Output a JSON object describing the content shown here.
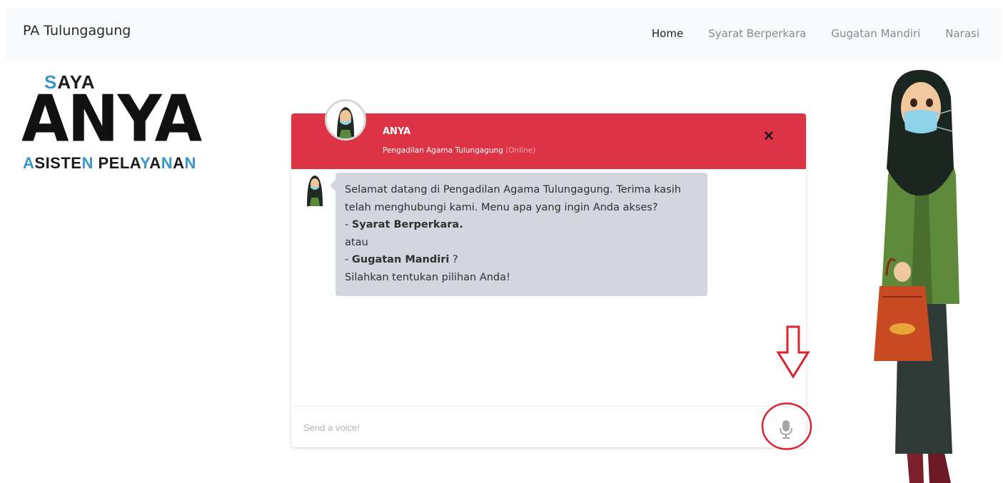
{
  "navbar": {
    "brand": "PA Tulungagung",
    "links": [
      {
        "label": "Home",
        "active": true
      },
      {
        "label": "Syarat Berperkara",
        "active": false
      },
      {
        "label": "Gugatan Mandiri",
        "active": false
      },
      {
        "label": "Narasi",
        "active": false
      }
    ]
  },
  "logo": {
    "saya_accent": "S",
    "saya_rest": "AYA",
    "anya": "ANYA",
    "asisten_parts": [
      "A",
      "SISTE",
      "N",
      " PELA",
      "Y",
      "A",
      "N",
      "A",
      "N"
    ],
    "accent_color": "#3b95c6"
  },
  "chat": {
    "name": "ANYA",
    "subtitle": "Pengadilan Agama Tulungagung",
    "status": "(Online)",
    "close_icon": "close-icon",
    "header_color": "#dc3444",
    "message": {
      "line1": "Selamat datang di Pengadilan Agama Tulungagung. Terima kasih telah menghubungi kami. Menu apa yang ingin Anda akses?",
      "opt1_prefix": "- ",
      "opt1": "Syarat Berperkara.",
      "or": "atau",
      "opt2_prefix": "- ",
      "opt2": "Gugatan Mandiri",
      "opt2_suffix": " ?",
      "closing": "Silahkan tentukan pilihan Anda!"
    },
    "input_placeholder": "Send a voice!",
    "mic_icon": "microphone-icon"
  },
  "annotation_color": "#d9232e"
}
